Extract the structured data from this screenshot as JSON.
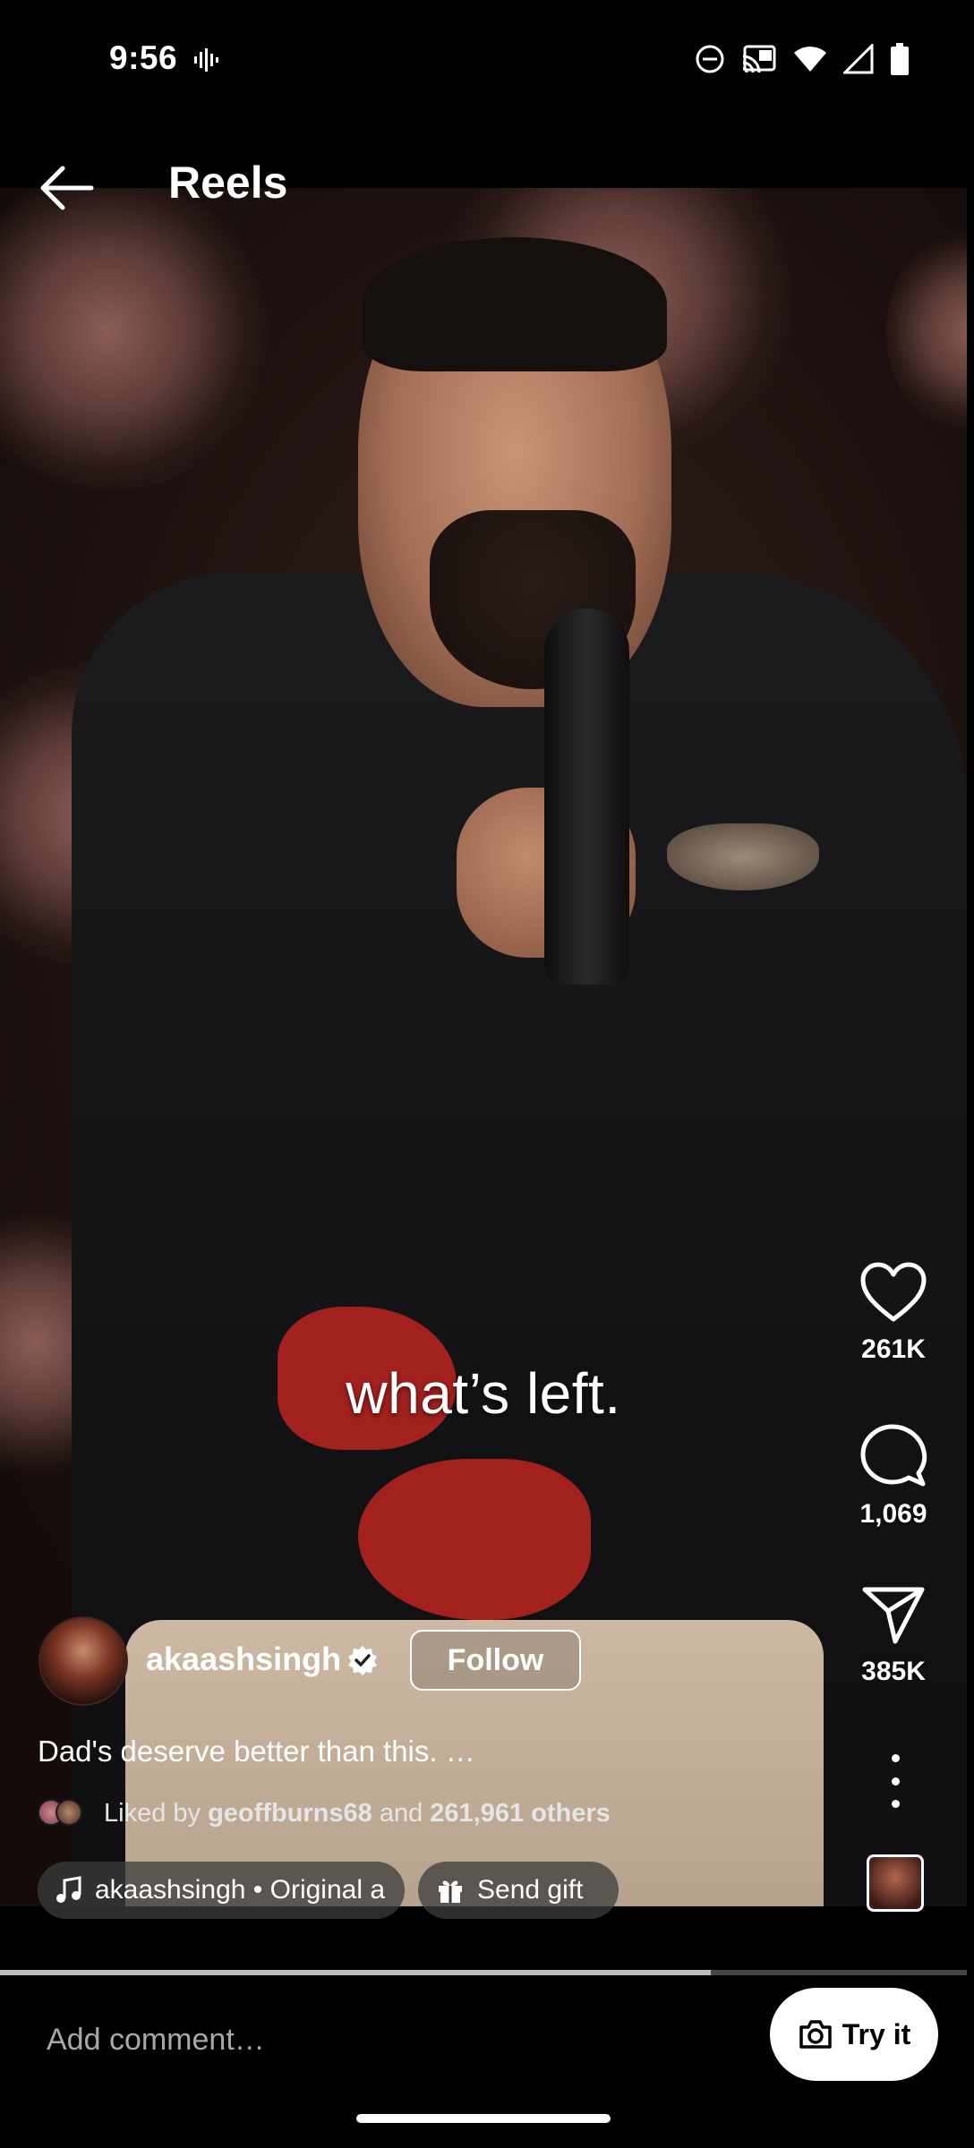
{
  "status_bar": {
    "time": "9:56",
    "icons": [
      "voice-activity-icon",
      "do-not-disturb-icon",
      "cast-icon",
      "wifi-icon",
      "signal-icon",
      "battery-icon"
    ]
  },
  "header": {
    "back_icon": "arrow-left-icon",
    "title": "Reels"
  },
  "video": {
    "caption": "what’s left."
  },
  "actions": {
    "like_count": "261K",
    "comment_count": "1,069",
    "share_count": "385K"
  },
  "author": {
    "username": "akaashsingh",
    "verified": true,
    "follow_label": "Follow"
  },
  "post": {
    "description": "Dad's deserve better than this. …",
    "liked_prefix": "Liked by",
    "liked_user": "geoffburns68",
    "liked_and": "and",
    "liked_others": "261,961 others"
  },
  "chips": {
    "audio_label": "akaashsingh • Original a",
    "gift_label": "Send gift"
  },
  "playback": {
    "progress": 0.735
  },
  "footer": {
    "comment_placeholder": "Add comment…",
    "try_label": "Try it"
  },
  "colors": {
    "background": "#000000",
    "accent_text": "#ffffff",
    "muted_text": "#a8a8a8"
  }
}
